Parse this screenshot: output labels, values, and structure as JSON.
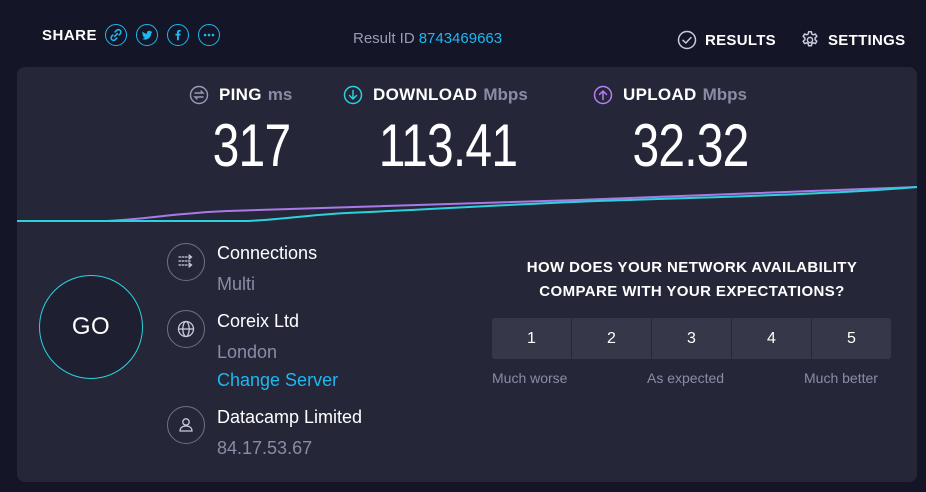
{
  "topbar": {
    "share_label": "SHARE",
    "share_icons": [
      "link-icon",
      "twitter-icon",
      "facebook-icon",
      "more-icon"
    ],
    "result_id_label": "Result ID",
    "result_id_value": "8743469663",
    "results_label": "RESULTS",
    "settings_label": "SETTINGS"
  },
  "metrics": {
    "ping": {
      "label": "PING",
      "unit": "ms",
      "value": "317"
    },
    "download": {
      "label": "DOWNLOAD",
      "unit": "Mbps",
      "value": "113.41"
    },
    "upload": {
      "label": "UPLOAD",
      "unit": "Mbps",
      "value": "32.32"
    }
  },
  "go_label": "GO",
  "connections": {
    "title": "Connections",
    "value": "Multi"
  },
  "server": {
    "name": "Coreix Ltd",
    "location": "London",
    "change_label": "Change Server"
  },
  "provider": {
    "name": "Datacamp Limited",
    "ip": "84.17.53.67"
  },
  "survey": {
    "question_line1": "HOW DOES YOUR NETWORK AVAILABILITY",
    "question_line2": "COMPARE WITH YOUR EXPECTATIONS?",
    "options": [
      "1",
      "2",
      "3",
      "4",
      "5"
    ],
    "low_label": "Much worse",
    "mid_label": "As expected",
    "high_label": "Much better"
  },
  "colors": {
    "accent_blue": "#1fb7f1",
    "download_cyan": "#2bd1dc",
    "upload_purple": "#b67ef7",
    "panel_bg": "#252739",
    "page_bg": "#141526"
  }
}
